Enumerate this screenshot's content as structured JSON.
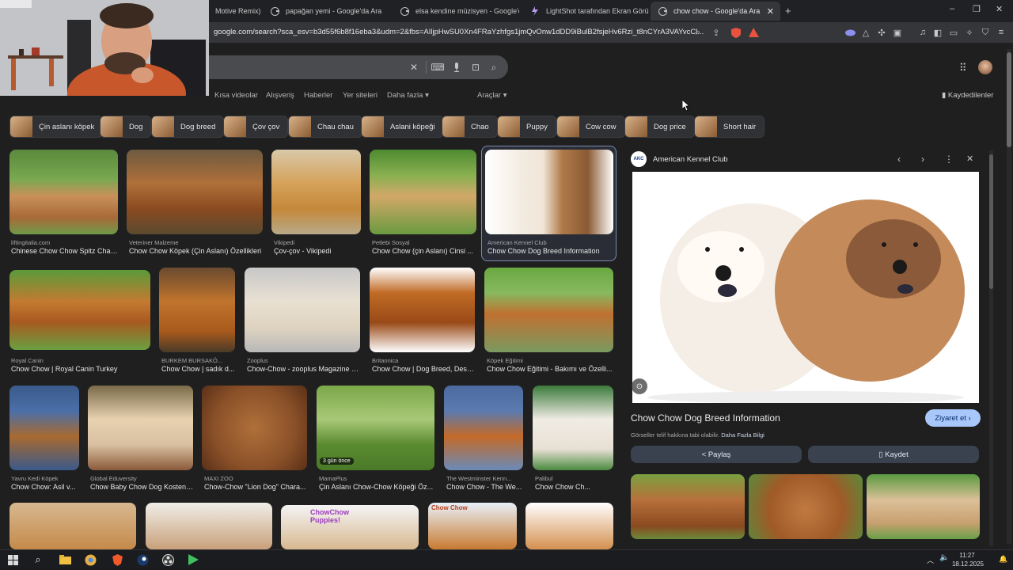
{
  "tabs": [
    {
      "label": "Motive Remix) |"
    },
    {
      "label": "papağan yemi - Google'da Ara"
    },
    {
      "label": "elsa kendine müzisyen - Google'da A"
    },
    {
      "label": "LightShot tarafından Ekran Görüntü"
    },
    {
      "label": "chow chow - Google'da Ara"
    }
  ],
  "address": {
    "url": "google.com/search?sca_esv=b3d55f6b8f16eba3&udm=2&fbs=AIljpHwSU0Xn4FRaYzhfgs1jmQvOnw1dDD9iBulB2fsjeHv6Rzi_t8nCYrA3VAYvcCl..."
  },
  "nav": {
    "tabs": [
      "Kısa videolar",
      "Alışveriş",
      "Haberler",
      "Yer siteleri",
      "Daha fazla"
    ],
    "tools": "Araçlar",
    "saved": "Kaydedilenler"
  },
  "chips": [
    "Çin aslanı köpek",
    "Dog",
    "Dog breed",
    "Çov çov",
    "Chau chau",
    "Aslani köpeği",
    "Chao",
    "Puppy",
    "Cow cow",
    "Dog price",
    "Short hair"
  ],
  "results": [
    {
      "source": "liftingitalia.com",
      "title": "Chinese Chow Chow Spitz Char..."
    },
    {
      "source": "Veteriner Malzeme",
      "title": "Chow Chow Köpek (Çin Aslanı) Özellikleri"
    },
    {
      "source": "Vikipedi",
      "title": "Çov-çov - Vikipedi"
    },
    {
      "source": "Petlebi Sosyal",
      "title": "Chow Chow (çin Aslanı) Cinsi ..."
    },
    {
      "source": "American Kennel Club",
      "title": "Chow Chow Dog Breed Information"
    },
    {
      "source": "Royal Canin",
      "title": "Chow Chow | Royal Canin Turkey"
    },
    {
      "source": "BURKEM BURSAKÖ...",
      "title": "Chow Chow | sadık d..."
    },
    {
      "source": "Zooplus",
      "title": "Chow-Chow - zooplus Magazine UK"
    },
    {
      "source": "Britannica",
      "title": "Chow Chow | Dog Breed, Desc..."
    },
    {
      "source": "Köpek Eğitimi",
      "title": "Chow Chow Eğitimi - Bakımı ve Özelli..."
    },
    {
      "source": "Yavru Kedi Köpek",
      "title": "Chow Chow: Asil v..."
    },
    {
      "source": "Global Eduversity",
      "title": "Chow Baby Chow Dog Kosten ..."
    },
    {
      "source": "MAXI ZOO",
      "title": "Chow-Chow \"Lion Dog\" Chara..."
    },
    {
      "source": "MamaPlus",
      "title": "Çin Aslanı Chow-Chow Köpeği Öz..."
    },
    {
      "source": "The Westminster Kenn...",
      "title": "Chow Chow - The We..."
    },
    {
      "source": "Palibul",
      "title": "Chow Chow Ch..."
    }
  ],
  "badge": "3 gün önce",
  "overlay": {
    "puppies": "ChowChow Puppies!",
    "year": "Chow Chow"
  },
  "panel": {
    "site": "American Kennel Club",
    "site_logo": "AKC",
    "title": "Chow Chow Dog Breed Information",
    "visit": "Ziyaret et",
    "copyright": "Görseller telif hakkına tabi olabilir.",
    "more_info": "Daha Fazla Bilgi",
    "share": "Paylaş",
    "save": "Kaydet"
  },
  "taskbar": {
    "time": "11:27",
    "date": "18.12.2025"
  },
  "colors": {
    "accent": "#a8c7fa",
    "selected_border": "#7a8bb0",
    "background": "#1f1f1f"
  }
}
